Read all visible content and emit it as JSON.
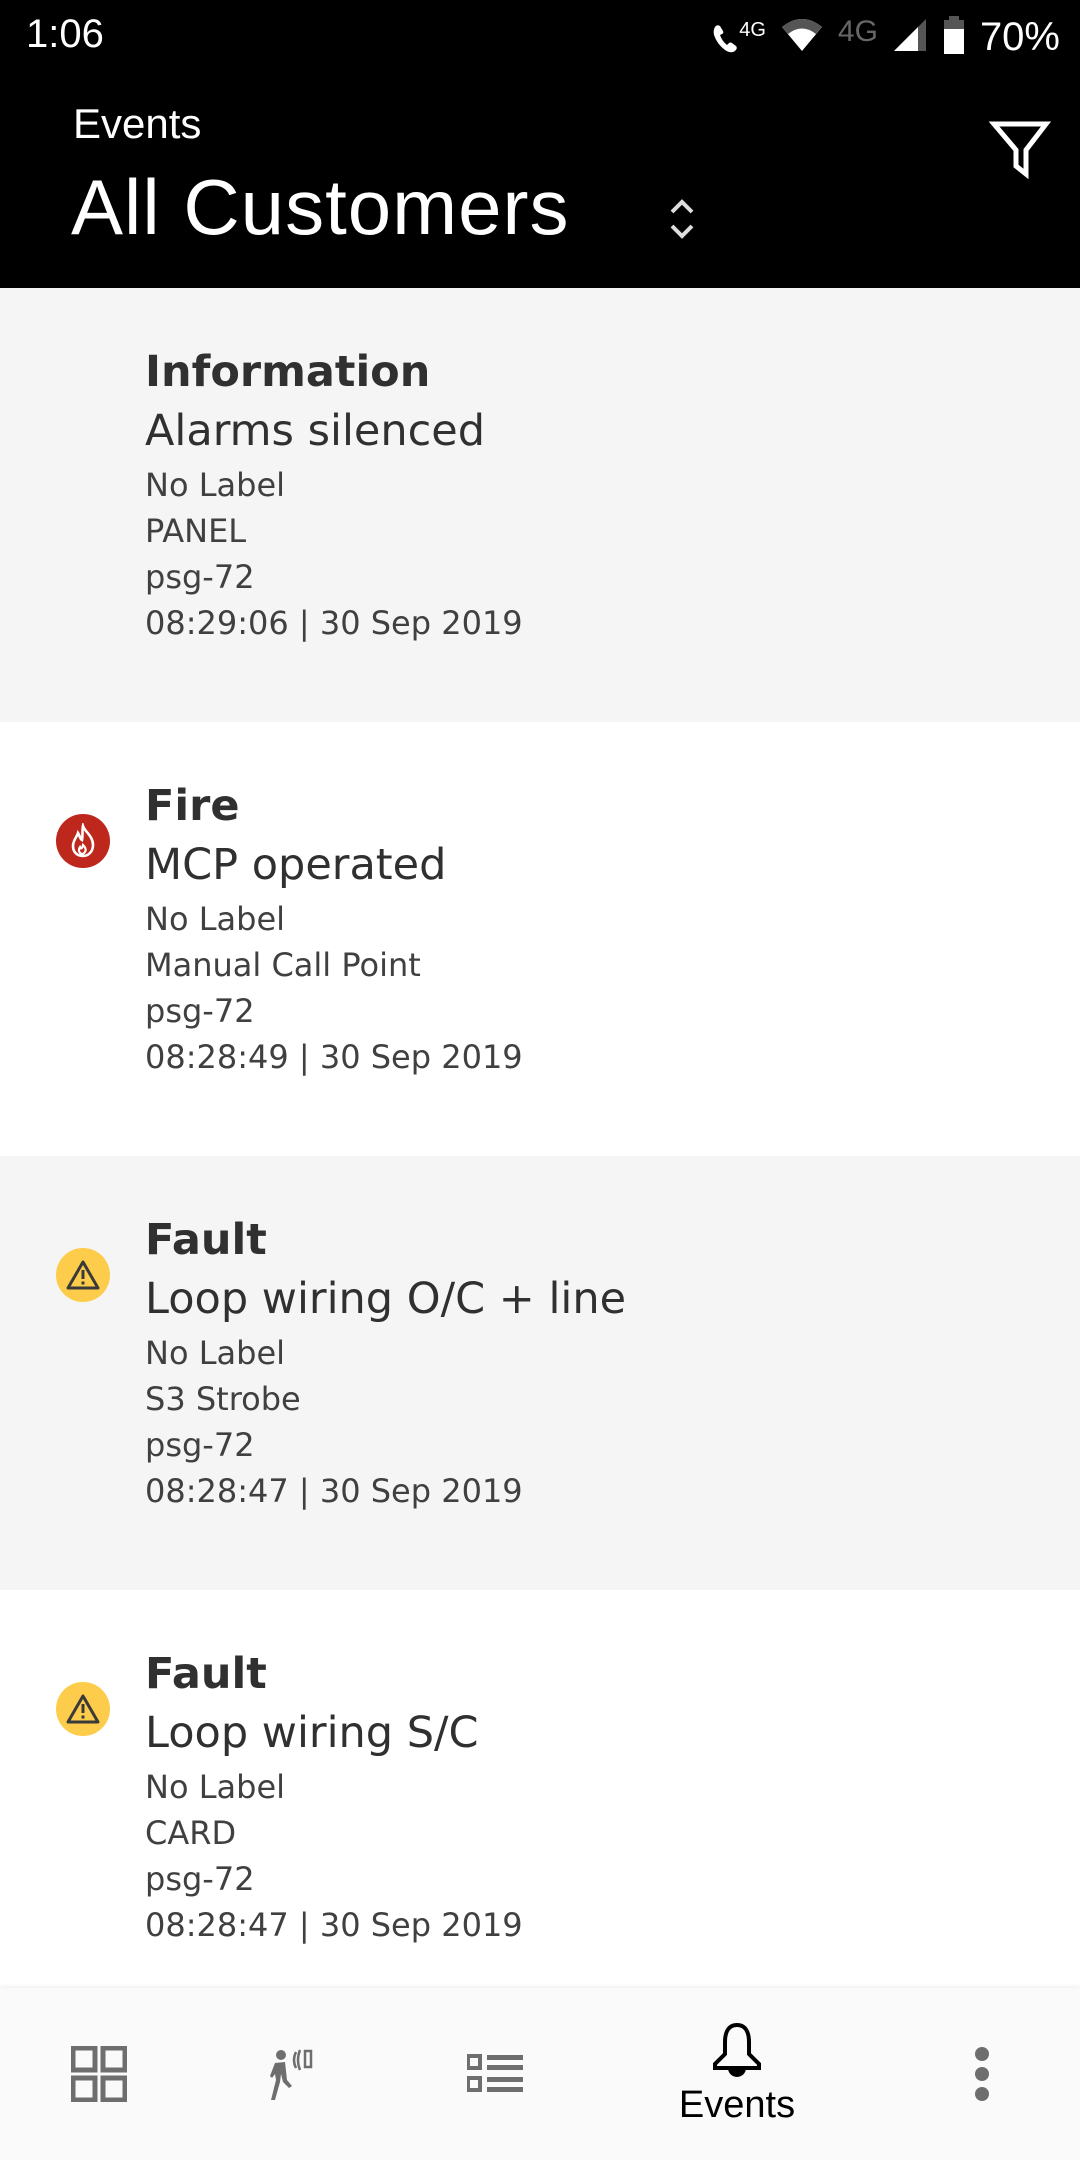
{
  "status_bar": {
    "time": "1:06",
    "volte_label": "4G",
    "mobile_label": "4G",
    "battery_percent": "70%",
    "battery_level": 0.7
  },
  "header": {
    "subtitle": "Events",
    "title": "All Customers",
    "selector_icon": "unfold-icon",
    "filter_icon": "filter-icon"
  },
  "colors": {
    "fire": "#be271c",
    "fault": "#fdcc4a",
    "header_bg": "#000000",
    "row_alt_bg": "#f5f5f5"
  },
  "events": [
    {
      "type": "Information",
      "icon": "none",
      "description": "Alarms silenced",
      "label": "No Label",
      "device": "PANEL",
      "site": "psg-72",
      "timestamp": "08:29:06 | 30 Sep 2019"
    },
    {
      "type": "Fire",
      "icon": "fire-icon",
      "description": "MCP operated",
      "label": "No Label",
      "device": "Manual Call Point",
      "site": "psg-72",
      "timestamp": "08:28:49 | 30 Sep 2019"
    },
    {
      "type": "Fault",
      "icon": "warning-icon",
      "description": "Loop wiring O/C + line",
      "label": "No Label",
      "device": "S3 Strobe",
      "site": "psg-72",
      "timestamp": "08:28:47 | 30 Sep 2019"
    },
    {
      "type": "Fault",
      "icon": "warning-icon",
      "description": "Loop wiring S/C",
      "label": "No Label",
      "device": "CARD",
      "site": "psg-72",
      "timestamp": "08:28:47 | 30 Sep 2019"
    }
  ],
  "bottom_nav": {
    "items": [
      {
        "icon": "dashboard-icon",
        "label": ""
      },
      {
        "icon": "walk-test-icon",
        "label": ""
      },
      {
        "icon": "list-icon",
        "label": ""
      },
      {
        "icon": "bell-icon",
        "label": "Events",
        "active": true
      },
      {
        "icon": "more-vert-icon",
        "label": ""
      }
    ]
  }
}
